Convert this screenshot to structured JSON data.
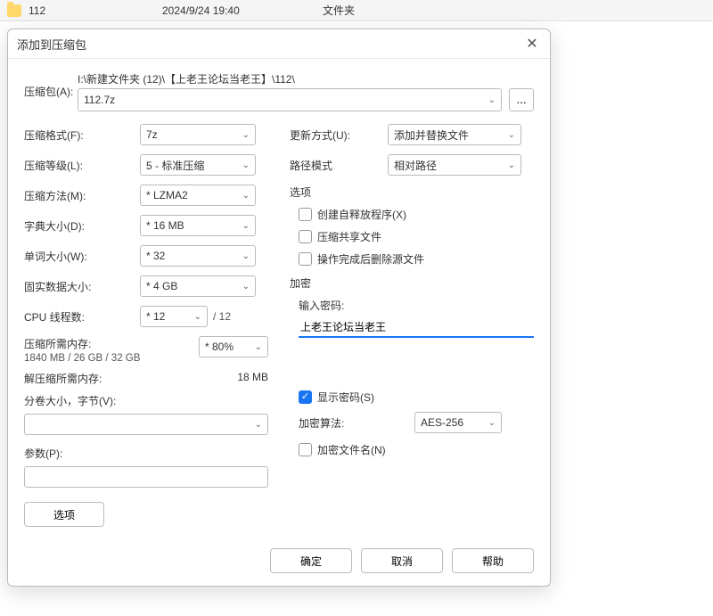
{
  "file_row": {
    "name": "112",
    "date": "2024/9/24 19:40",
    "type": "文件夹"
  },
  "dialog": {
    "title": "添加到压缩包",
    "archive_label": "压缩包(A):",
    "archive_path": "I:\\新建文件夹 (12)\\【上老王论坛当老王】\\112\\",
    "archive_value": "112.7z",
    "browse_label": "...",
    "left": {
      "format_label": "压缩格式(F):",
      "format_value": "7z",
      "level_label": "压缩等级(L):",
      "level_value": "5 - 标准压缩",
      "method_label": "压缩方法(M):",
      "method_value": "* LZMA2",
      "dict_label": "字典大小(D):",
      "dict_value": "* 16 MB",
      "word_label": "单词大小(W):",
      "word_value": "* 32",
      "solid_label": "固实数据大小:",
      "solid_value": "* 4 GB",
      "threads_label": "CPU 线程数:",
      "threads_value": "* 12",
      "threads_total": "/ 12",
      "mem_compress_label": "压缩所需内存:",
      "mem_compress_value": "1840 MB / 26 GB / 32 GB",
      "mem_percent": "* 80%",
      "mem_decompress_label": "解压缩所需内存:",
      "mem_decompress_value": "18 MB",
      "split_label": "分卷大小，字节(V):",
      "split_value": "",
      "params_label": "参数(P):",
      "params_value": "",
      "options_btn": "选项"
    },
    "right": {
      "update_label": "更新方式(U):",
      "update_value": "添加并替换文件",
      "path_label": "路径模式",
      "path_value": "相对路径",
      "options_group": "选项",
      "sfx_label": "创建自释放程序(X)",
      "shared_label": "压缩共享文件",
      "delete_label": "操作完成后删除源文件",
      "encrypt_group": "加密",
      "pwd_label": "输入密码:",
      "pwd_value": "上老王论坛当老王",
      "show_pwd_label": "显示密码(S)",
      "algo_label": "加密算法:",
      "algo_value": "AES-256",
      "encrypt_names_label": "加密文件名(N)"
    },
    "footer": {
      "ok": "确定",
      "cancel": "取消",
      "help": "帮助"
    }
  }
}
